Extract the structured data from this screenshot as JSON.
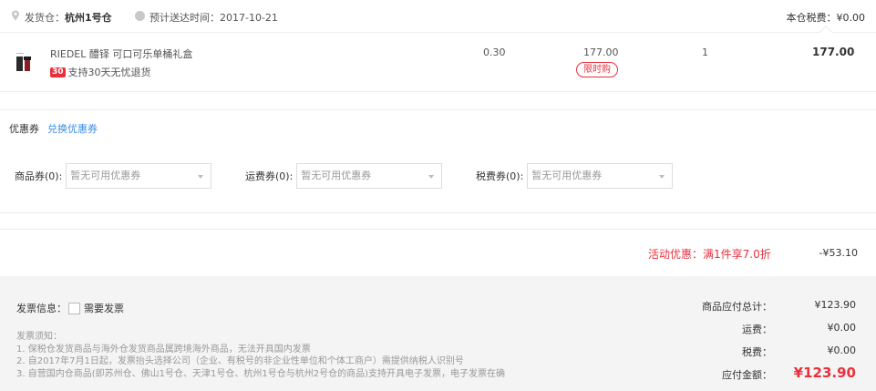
{
  "shipping": {
    "warehouse_label": "发货仓：",
    "warehouse_value": "杭州1号仓",
    "eta_label": "预计送达时间：",
    "eta_value": "2017-10-21",
    "tax_text": "本仓税费：¥0.00"
  },
  "product": {
    "name": "RIEDEL 醴铎 可口可乐单桶礼盒",
    "badge": "30",
    "return_policy": "支持30天无忧退货",
    "weight": "0.30",
    "price": "177.00",
    "limit_tag": "限时购",
    "quantity": "1",
    "subtotal": "177.00"
  },
  "coupons": {
    "title": "优惠券",
    "exchange_link": "兑换优惠券",
    "goods_label": "商品券(0):",
    "goods_placeholder": "暂无可用优惠券",
    "freight_label": "运费券(0):",
    "freight_placeholder": "暂无可用优惠券",
    "tax_label": "税费券(0):",
    "tax_placeholder": "暂无可用优惠券"
  },
  "promotion": {
    "label": "活动优惠：满1件享7.0折",
    "value": "-¥53.10"
  },
  "invoice": {
    "label": "发票信息：",
    "checkbox_label": "需要发票",
    "notes_title": "发票须知：",
    "notes": [
      "1. 保税仓发货商品与海外仓发货商品属跨境海外商品，无法开具国内发票",
      "2. 自2017年7月1日起，发票抬头选择公司（企业、有税号的非企业性单位和个体工商户）需提供纳税人识别号",
      "3. 自营国内仓商品(即苏州仓、佛山1号仓、天津1号仓、杭州1号仓与杭州2号仓的商品)支持开具电子发票，电子发票在确"
    ]
  },
  "summary": {
    "goods_total_label": "商品应付总计：",
    "goods_total_value": "¥123.90",
    "freight_label": "运费：",
    "freight_value": "¥0.00",
    "tax_label": "税费：",
    "tax_value": "¥0.00",
    "payable_label": "应付金额：",
    "payable_value": "¥123.90"
  },
  "colors": {
    "accent_red": "#e8303c",
    "link_blue": "#3a8ee6"
  }
}
